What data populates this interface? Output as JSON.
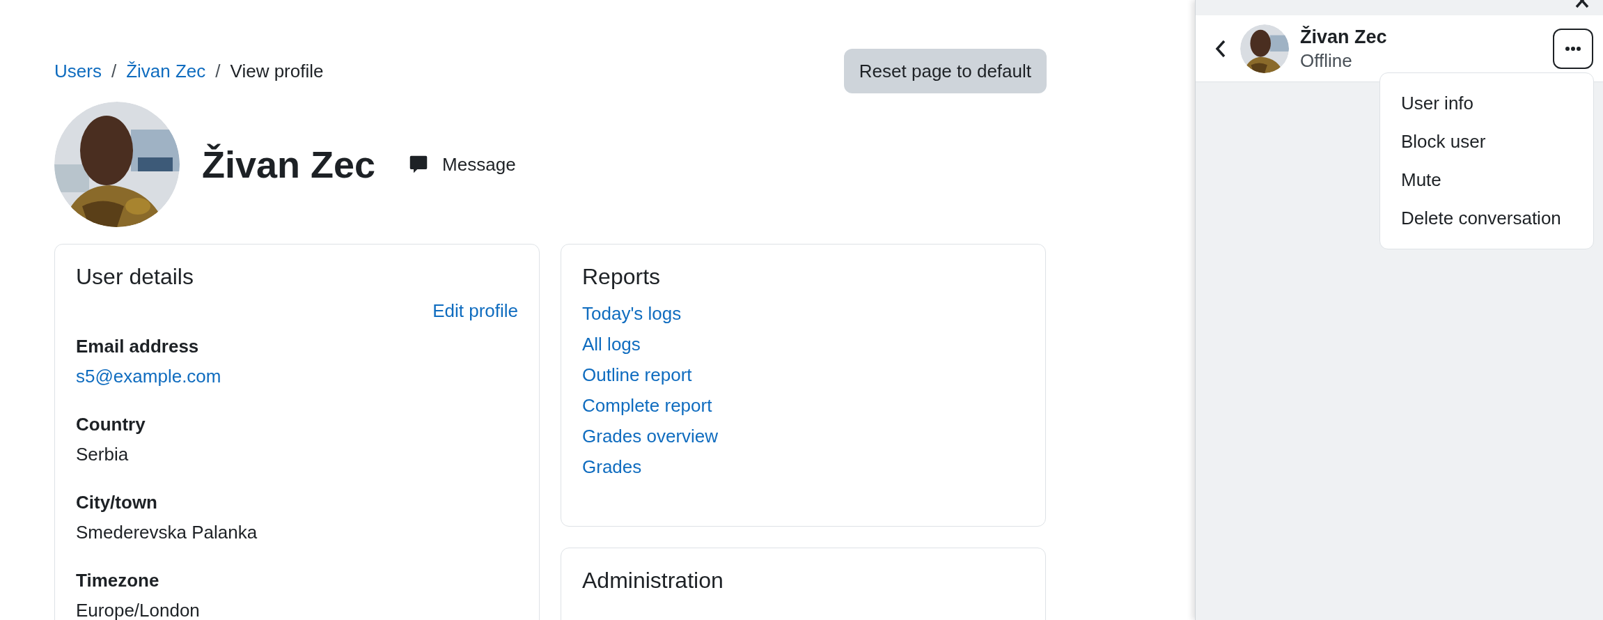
{
  "breadcrumb": [
    {
      "label": "Users",
      "link": true
    },
    {
      "label": "/",
      "kind": "separator"
    },
    {
      "label": "Živan Zec",
      "link": true
    },
    {
      "label": "/",
      "kind": "separator"
    },
    {
      "label": "View profile",
      "link": false
    }
  ],
  "reset_button": "Reset page to default",
  "profile": {
    "name": "Živan Zec",
    "message_button": "Message"
  },
  "user_details": {
    "title": "User details",
    "edit_link": "Edit profile",
    "fields": [
      {
        "label": "Email address",
        "value": "s5@example.com",
        "link": true
      },
      {
        "label": "Country",
        "value": "Serbia",
        "link": false
      },
      {
        "label": "City/town",
        "value": "Smederevska Palanka",
        "link": false
      },
      {
        "label": "Timezone",
        "value": "Europe/London",
        "link": false
      }
    ]
  },
  "reports": {
    "title": "Reports",
    "links": [
      "Today's logs",
      "All logs",
      "Outline report",
      "Complete report",
      "Grades overview",
      "Grades"
    ]
  },
  "administration": {
    "title": "Administration"
  },
  "drawer": {
    "contact": {
      "name": "Živan Zec",
      "status": "Offline"
    },
    "menu_open": true,
    "menu": [
      "User info",
      "Block user",
      "Mute",
      "Delete conversation"
    ]
  }
}
